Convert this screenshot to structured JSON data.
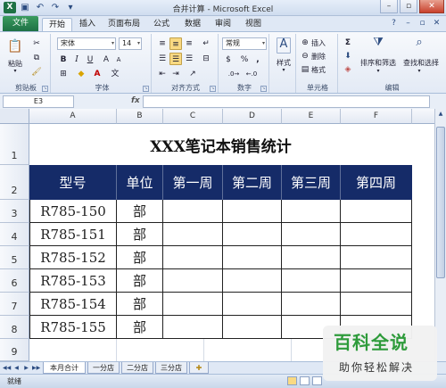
{
  "window": {
    "title": "合并计算 - Microsoft Excel"
  },
  "tabs": {
    "file": "文件",
    "items": [
      "开始",
      "插入",
      "页面布局",
      "公式",
      "数据",
      "审阅",
      "视图"
    ]
  },
  "ribbon": {
    "groups": {
      "clipboard": "剪贴板",
      "font": "字体",
      "alignment": "对齐方式",
      "number": "数字",
      "cells": "单元格",
      "editing": "编辑"
    },
    "paste_label": "粘贴",
    "font_name": "宋体",
    "font_size": "14",
    "number_format": "常规",
    "styles_label": "样式",
    "insert_label": "插入",
    "delete_label": "删除",
    "format_label": "格式",
    "sort_label": "排序和筛选",
    "find_label": "查找和选择",
    "sigma": "Σ",
    "bold": "B",
    "italic": "I",
    "underline": "U",
    "percent": "%",
    "comma": ","
  },
  "formula_bar": {
    "name_box": "E3",
    "fx": "fx",
    "value": ""
  },
  "sheet": {
    "columns": [
      "A",
      "B",
      "C",
      "D",
      "E",
      "F"
    ],
    "rows": [
      "1",
      "2",
      "3",
      "4",
      "5",
      "6",
      "7",
      "8",
      "9"
    ],
    "title": "XXX笔记本销售统计",
    "headers": [
      "型号",
      "单位",
      "第一周",
      "第二周",
      "第三周",
      "第四周"
    ],
    "data": [
      [
        "R785-150",
        "部"
      ],
      [
        "R785-151",
        "部"
      ],
      [
        "R785-152",
        "部"
      ],
      [
        "R785-153",
        "部"
      ],
      [
        "R785-154",
        "部"
      ],
      [
        "R785-155",
        "部"
      ]
    ]
  },
  "sheet_tabs": [
    "本月合计",
    "一分店",
    "二分店",
    "三分店"
  ],
  "status": "就绪",
  "watermark": {
    "line1": "百科全说",
    "line2": "助你轻松解决"
  }
}
